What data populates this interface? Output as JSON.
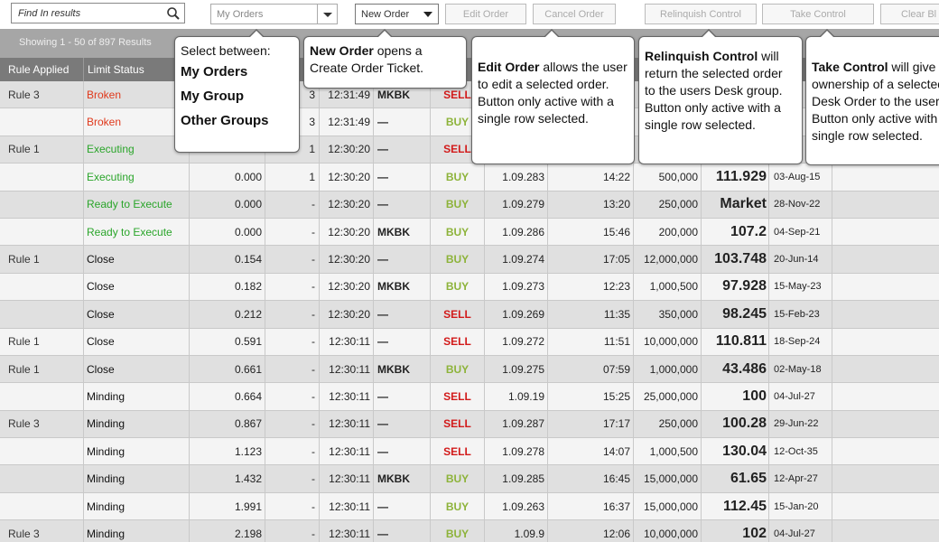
{
  "toolbar": {
    "search_placeholder": "Find In results",
    "group_select_value": "My Orders",
    "new_order": "New Order",
    "edit_order": "Edit Order",
    "cancel_order": "Cancel Order",
    "relinquish_control": "Relinquish Control",
    "take_control": "Take Control",
    "clear": "Clear Bl"
  },
  "status_bar": {
    "showing": "Showing 1 - 50 of 897 Results"
  },
  "table": {
    "headers": [
      "Rule Applied",
      "Limit Status"
    ],
    "rows": [
      {
        "rule": "Rule 3",
        "status": "Broken",
        "status_color": "red",
        "num": "",
        "qty": "3",
        "time": "12:31:49",
        "broker": "MKBK",
        "side": "SELL",
        "price": "",
        "time2": "",
        "amount": "",
        "rate": "",
        "date": ""
      },
      {
        "rule": "",
        "status": "Broken",
        "status_color": "red",
        "num": "",
        "qty": "3",
        "time": "12:31:49",
        "broker": "—",
        "side": "BUY",
        "price": "",
        "time2": "",
        "amount": "",
        "rate": "",
        "date": ""
      },
      {
        "rule": "Rule 1",
        "status": "Executing",
        "status_color": "green",
        "num": "",
        "qty": "1",
        "time": "12:30:20",
        "broker": "—",
        "side": "SELL",
        "price": "",
        "time2": "",
        "amount": "",
        "rate": "",
        "date": ""
      },
      {
        "rule": "",
        "status": "Executing",
        "status_color": "green",
        "num": "0.000",
        "qty": "1",
        "time": "12:30:20",
        "broker": "—",
        "side": "BUY",
        "price": "1.09.283",
        "time2": "14:22",
        "amount": "500,000",
        "rate": "111.929",
        "date": "03-Aug-15"
      },
      {
        "rule": "",
        "status": "Ready to Execute",
        "status_color": "green",
        "num": "0.000",
        "qty": "-",
        "time": "12:30:20",
        "broker": "—",
        "side": "BUY",
        "price": "1.09.279",
        "time2": "13:20",
        "amount": "250,000",
        "rate": "Market",
        "date": "28-Nov-22"
      },
      {
        "rule": "",
        "status": "Ready to Execute",
        "status_color": "green",
        "num": "0.000",
        "qty": "-",
        "time": "12:30:20",
        "broker": "MKBK",
        "side": "BUY",
        "price": "1.09.286",
        "time2": "15:46",
        "amount": "200,000",
        "rate": "107.2",
        "date": "04-Sep-21"
      },
      {
        "rule": "Rule 1",
        "status": "Close",
        "status_color": "black",
        "num": "0.154",
        "qty": "-",
        "time": "12:30:20",
        "broker": "—",
        "side": "BUY",
        "price": "1.09.274",
        "time2": "17:05",
        "amount": "12,000,000",
        "rate": "103.748",
        "date": "20-Jun-14"
      },
      {
        "rule": "",
        "status": "Close",
        "status_color": "black",
        "num": "0.182",
        "qty": "-",
        "time": "12:30:20",
        "broker": "MKBK",
        "side": "BUY",
        "price": "1.09.273",
        "time2": "12:23",
        "amount": "1,000,500",
        "rate": "97.928",
        "date": "15-May-23"
      },
      {
        "rule": "",
        "status": "Close",
        "status_color": "black",
        "num": "0.212",
        "qty": "-",
        "time": "12:30:20",
        "broker": "—",
        "side": "SELL",
        "price": "1.09.269",
        "time2": "11:35",
        "amount": "350,000",
        "rate": "98.245",
        "date": "15-Feb-23"
      },
      {
        "rule": "Rule 1",
        "status": "Close",
        "status_color": "black",
        "num": "0.591",
        "qty": "-",
        "time": "12:30:11",
        "broker": "—",
        "side": "SELL",
        "price": "1.09.272",
        "time2": "11:51",
        "amount": "10,000,000",
        "rate": "110.811",
        "date": "18-Sep-24"
      },
      {
        "rule": "Rule 1",
        "status": "Close",
        "status_color": "black",
        "num": "0.661",
        "qty": "-",
        "time": "12:30:11",
        "broker": "MKBK",
        "side": "BUY",
        "price": "1.09.275",
        "time2": "07:59",
        "amount": "1,000,000",
        "rate": "43.486",
        "date": "02-May-18"
      },
      {
        "rule": "",
        "status": "Minding",
        "status_color": "black",
        "num": "0.664",
        "qty": "-",
        "time": "12:30:11",
        "broker": "—",
        "side": "SELL",
        "price": "1.09.19",
        "time2": "15:25",
        "amount": "25,000,000",
        "rate": "100",
        "date": "04-Jul-27"
      },
      {
        "rule": "Rule 3",
        "status": "Minding",
        "status_color": "black",
        "num": "0.867",
        "qty": "-",
        "time": "12:30:11",
        "broker": "—",
        "side": "SELL",
        "price": "1.09.287",
        "time2": "17:17",
        "amount": "250,000",
        "rate": "100.28",
        "date": "29-Jun-22"
      },
      {
        "rule": "",
        "status": "Minding",
        "status_color": "black",
        "num": "1.123",
        "qty": "-",
        "time": "12:30:11",
        "broker": "—",
        "side": "SELL",
        "price": "1.09.278",
        "time2": "14:07",
        "amount": "1,000,500",
        "rate": "130.04",
        "date": "12-Oct-35"
      },
      {
        "rule": "",
        "status": "Minding",
        "status_color": "black",
        "num": "1.432",
        "qty": "-",
        "time": "12:30:11",
        "broker": "MKBK",
        "side": "BUY",
        "price": "1.09.285",
        "time2": "16:45",
        "amount": "15,000,000",
        "rate": "61.65",
        "date": "12-Apr-27"
      },
      {
        "rule": "",
        "status": "Minding",
        "status_color": "black",
        "num": "1.991",
        "qty": "-",
        "time": "12:30:11",
        "broker": "—",
        "side": "BUY",
        "price": "1.09.263",
        "time2": "16:37",
        "amount": "15,000,000",
        "rate": "112.45",
        "date": "15-Jan-20"
      },
      {
        "rule": "Rule 3",
        "status": "Minding",
        "status_color": "black",
        "num": "2.198",
        "qty": "-",
        "time": "12:30:11",
        "broker": "—",
        "side": "BUY",
        "price": "1.09.9",
        "time2": "12:06",
        "amount": "10,000,000",
        "rate": "102",
        "date": "04-Jul-27"
      }
    ]
  },
  "callouts": {
    "select": {
      "intro": "Select between:",
      "options": [
        "My Orders",
        "My Group",
        "Other Groups"
      ]
    },
    "new_order": {
      "title": "New Order",
      "text": " opens a Create Order Ticket."
    },
    "edit_order": {
      "title": "Edit Order",
      "text": " allows the user to edit a selected order. Button only active with a single row selected."
    },
    "relinquish": {
      "title": "Relinquish Control",
      "text": " will return the selected order to the users Desk group. Button only active with a single row selected."
    },
    "take": {
      "title": "Take Control",
      "text": " will give ownership of a selected Desk Order to the user. Button only active with a single row selected."
    }
  },
  "colors": {
    "status_red": "#e0391c",
    "status_green": "#2aa52a",
    "side_sell": "#d21a1a",
    "side_buy": "#8db33a",
    "header_bg": "#7a7a7a",
    "band_bg": "#a6a6a6"
  }
}
